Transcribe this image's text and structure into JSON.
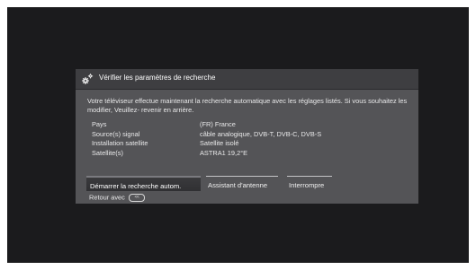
{
  "dialog": {
    "title": "Vérifier les paramètres de recherche",
    "icon": "gear-icon",
    "description": "Votre téléviseur effectue maintenant la recherche automatique avec les réglages listés. Si vous souhaitez les modifier, Veuillez- revenir en arrière.",
    "params": [
      {
        "label": "Pays",
        "value": "(FR) France"
      },
      {
        "label": "Source(s) signal",
        "value": "câble analogique, DVB-T, DVB-C, DVB-S"
      },
      {
        "label": "Installation satellite",
        "value": "Satellite isolé"
      },
      {
        "label": "Satellite(s)",
        "value": "ASTRA1 19,2°E"
      }
    ],
    "buttons": {
      "start": "Démarrer la recherche autom.",
      "assistant": "Assistant d'antenne",
      "stop": "Interrompre"
    },
    "footer": {
      "text": "Retour avec",
      "key_icon": "back-key-icon",
      "key_glyph": "<<"
    }
  },
  "colors": {
    "screen": "#1b1b1d",
    "dialog": "#545457",
    "header": "#3e3e41",
    "text": "#e9e9ea"
  }
}
